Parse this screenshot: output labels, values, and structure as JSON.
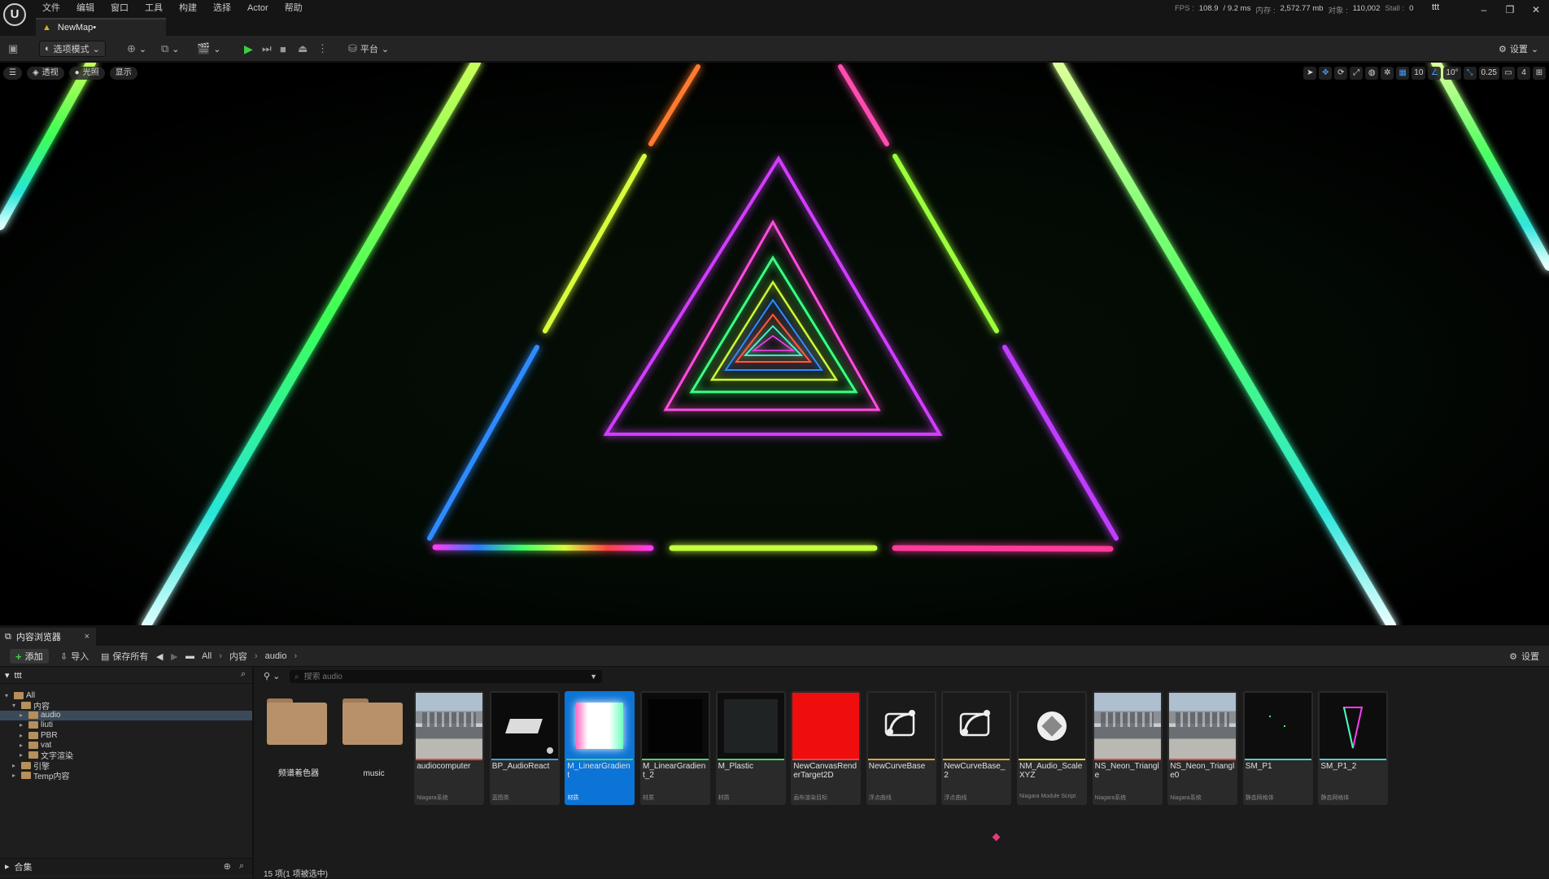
{
  "menu": [
    "文件",
    "编辑",
    "窗口",
    "工具",
    "构建",
    "选择",
    "Actor",
    "帮助"
  ],
  "logo_text": "U",
  "level_tab": "NewMap•",
  "stats": {
    "fps_label": "FPS :",
    "fps_value": "108.9",
    "ms_value": "/ 9.2 ms",
    "mem_label": "内存 :",
    "mem_value": "2,572.77 mb",
    "obj_label": "对象 :",
    "obj_value": "110,002",
    "stall_label": "Stall :",
    "stall_value": "0"
  },
  "project": "ttt",
  "toolbar": {
    "mode": "选项模式",
    "platform": "平台",
    "settings": "设置"
  },
  "viewport": {
    "perspective": "透视",
    "lit": "光照",
    "show": "显示",
    "grid_snap": "10",
    "rot_snap": "10°",
    "scale_snap": "0.25",
    "camera_speed": "4"
  },
  "content_browser": {
    "tab_title": "内容浏览器",
    "add": "添加",
    "import": "导入",
    "save_all": "保存所有",
    "breadcrumb": [
      "All",
      "内容",
      "audio"
    ],
    "settings": "设置",
    "tree_root": "ttt",
    "tree": [
      {
        "label": "All",
        "level": 0,
        "expanded": true
      },
      {
        "label": "内容",
        "level": 1,
        "expanded": true
      },
      {
        "label": "audio",
        "level": 2,
        "selected": true
      },
      {
        "label": "liuti",
        "level": 2
      },
      {
        "label": "PBR",
        "level": 2
      },
      {
        "label": "vat",
        "level": 2
      },
      {
        "label": "文字渲染",
        "level": 2
      },
      {
        "label": "引擎",
        "level": 1
      },
      {
        "label": "Temp内容",
        "level": 1
      }
    ],
    "collections": "合集",
    "search_placeholder": "搜索 audio",
    "status": "15 项(1 项被选中)",
    "assets": [
      {
        "name": "频谱着色器",
        "type": "",
        "kind": "folder",
        "bar": ""
      },
      {
        "name": "music",
        "type": "",
        "kind": "folder",
        "bar": ""
      },
      {
        "name": "audiocomputer",
        "type": "Niagara系统",
        "kind": "scene",
        "bar": "#e04a4a"
      },
      {
        "name": "BP_AudioReact",
        "type": "蓝图类",
        "kind": "bp",
        "bar": "#3aa0e8"
      },
      {
        "name": "M_LinearGradient",
        "type": "材质",
        "kind": "gradient",
        "bar": "#4fd06a",
        "selected": true
      },
      {
        "name": "M_LinearGradient_2",
        "type": "材质",
        "kind": "black",
        "bar": "#4fd06a"
      },
      {
        "name": "M_Plastic",
        "type": "材质",
        "kind": "dark",
        "bar": "#4fd06a"
      },
      {
        "name": "NewCanvasRenderTarget2D",
        "type": "画布渲染目标",
        "kind": "red",
        "bar": "#e04a4a"
      },
      {
        "name": "NewCurveBase",
        "type": "浮点曲线",
        "kind": "curve",
        "bar": "#d9a441"
      },
      {
        "name": "NewCurveBase_2",
        "type": "浮点曲线",
        "kind": "curve",
        "bar": "#d9a441"
      },
      {
        "name": "NM_Audio_ScaleXYZ",
        "type": "Niagara Module Script",
        "kind": "module",
        "bar": "#e8d84a"
      },
      {
        "name": "NS_Neon_Triangle",
        "type": "Niagara系统",
        "kind": "scene",
        "bar": "#e04a4a"
      },
      {
        "name": "NS_Neon_Triangle0",
        "type": "Niagara系统",
        "kind": "scene",
        "bar": "#e04a4a"
      },
      {
        "name": "SM_P1",
        "type": "静态网格体",
        "kind": "dots",
        "bar": "#4ad0c8"
      },
      {
        "name": "SM_P1_2",
        "type": "静态网格体",
        "kind": "tri",
        "bar": "#4ad0c8"
      }
    ]
  },
  "colors": {
    "accent": "#0c74d6",
    "play": "#37d23f",
    "folder": "#b8916a"
  }
}
